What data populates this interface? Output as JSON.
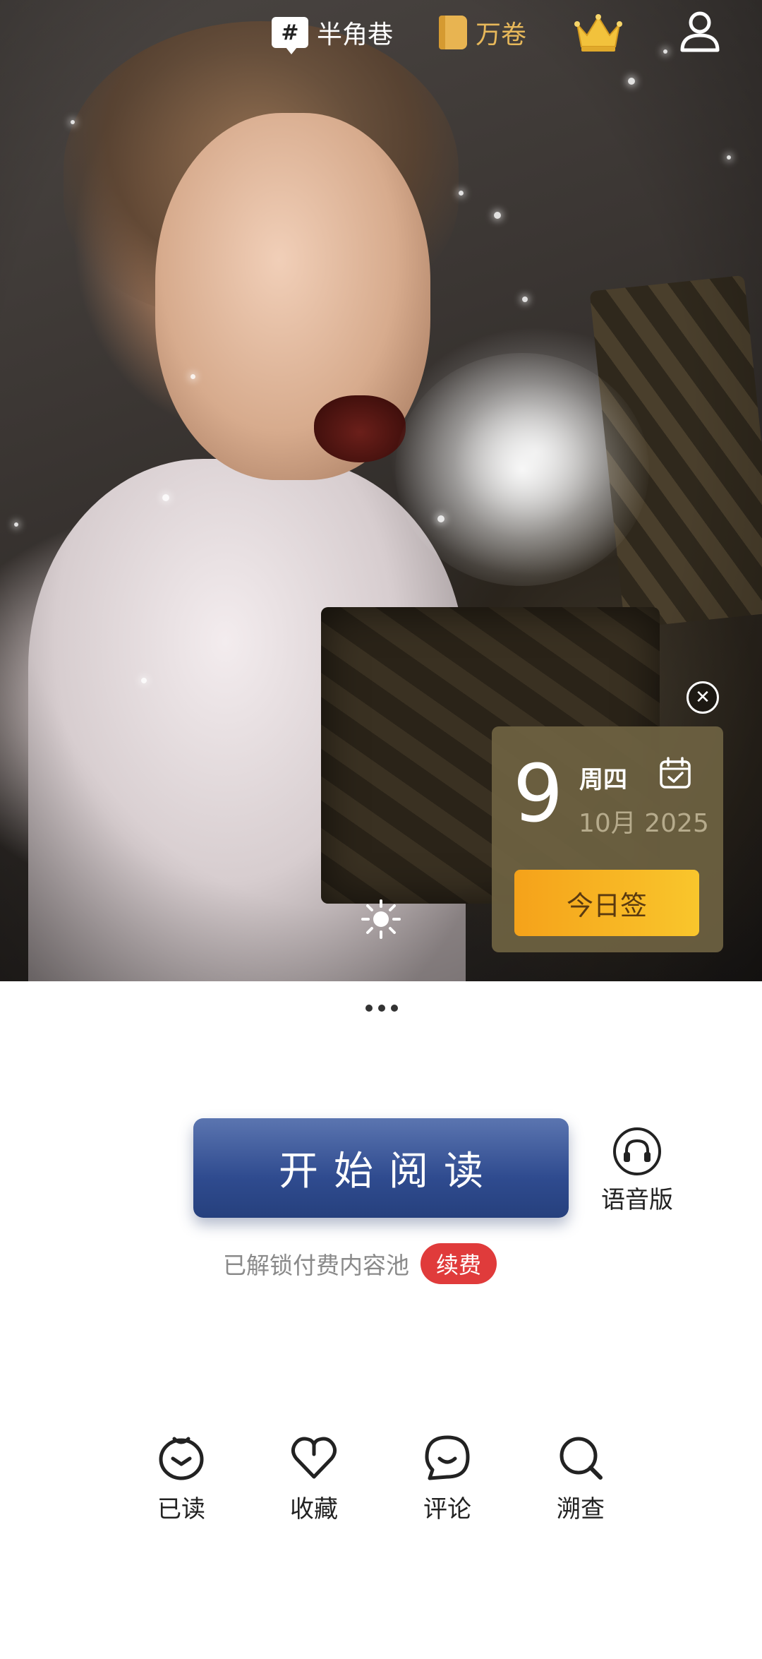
{
  "top_bar": {
    "tag_label": "半角巷",
    "wanjuan_label": "万卷"
  },
  "date_card": {
    "day": "9",
    "weekday": "周四",
    "month_year": "10月 2025",
    "checkin_label": "今日签"
  },
  "main": {
    "read_button_label": "开始阅读",
    "audio_label": "语音版",
    "unlock_text": "已解锁付费内容池",
    "renew_label": "续费"
  },
  "actions": [
    {
      "label": "已读",
      "icon": "read-icon"
    },
    {
      "label": "收藏",
      "icon": "heart-icon"
    },
    {
      "label": "评论",
      "icon": "comment-icon"
    },
    {
      "label": "溯查",
      "icon": "search-icon"
    }
  ],
  "colors": {
    "accent_gold": "#e7b85a",
    "read_button_blue": "#2f4b8f",
    "checkin_orange": "#f5a21a",
    "renew_red": "#e03b3b"
  }
}
